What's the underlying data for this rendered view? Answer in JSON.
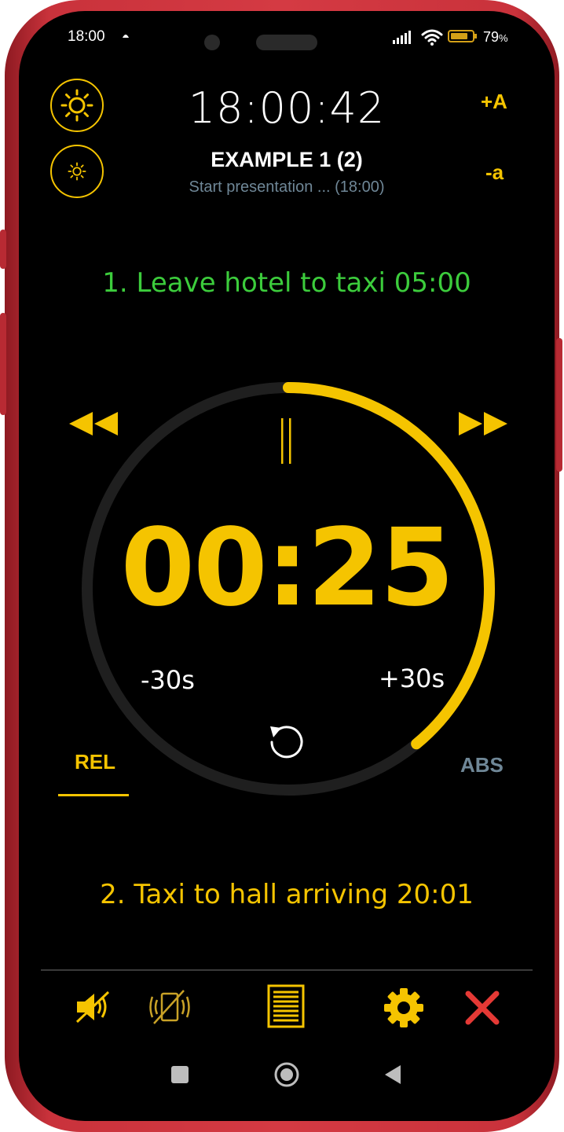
{
  "status_bar": {
    "time": "18:00",
    "battery_percent": "79",
    "battery_unit": "%",
    "battery_level": 0.79
  },
  "header": {
    "clock": "18:00:42",
    "title": "EXAMPLE 1 (2)",
    "subtitle": "Start presentation ... (18:00)",
    "font_increase_label": "+A",
    "font_decrease_label": "-a"
  },
  "steps": {
    "current": "1. Leave hotel to taxi  05:00",
    "next": "2. Taxi to hall arriving 20:01"
  },
  "timer": {
    "display": "00:25",
    "progress_elapsed": 0.39,
    "minus_label": "-30s",
    "plus_label": "+30s"
  },
  "tabs": {
    "rel_label": "REL",
    "abs_label": "ABS",
    "active": "REL"
  },
  "colors": {
    "accent": "#f5c400",
    "current_step": "#3ccc3c",
    "close": "#e53935",
    "muted": "#6f8797"
  },
  "toolbar": {
    "icons": [
      "mute-icon",
      "vibrate-off-icon",
      "list-icon",
      "gear-icon",
      "close-icon"
    ]
  }
}
